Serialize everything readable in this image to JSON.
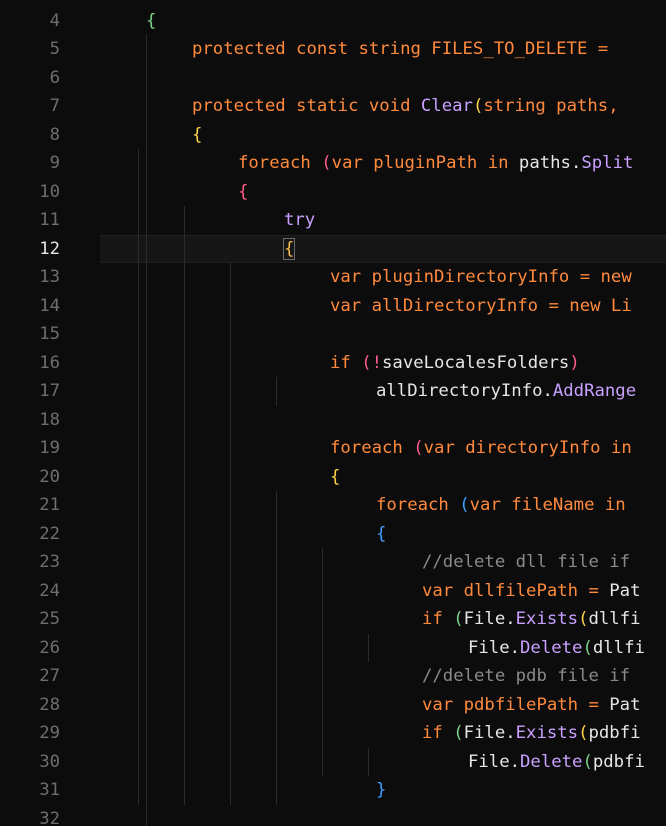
{
  "theme": {
    "background": "#0c0c0c",
    "current_line_background": "#161616",
    "line_number_color": "#6e6e6e",
    "active_line_number_color": "#e6e6e6",
    "colors": {
      "keyword": "#ff8a3d",
      "plain": "#e6e6e6",
      "method": "#c9a0ff",
      "comment": "#8a8a8a",
      "bracket_gold": "#ffd24a",
      "bracket_pink": "#ff5c8a",
      "bracket_green": "#7bd389",
      "bracket_blue": "#3ea0ff",
      "bracket_orange": "#f6b94c"
    }
  },
  "editor": {
    "active_line": "12",
    "lines": [
      {
        "n": "4",
        "indent": 1,
        "tokens": [
          {
            "t": "{",
            "c": "bracket_green"
          }
        ]
      },
      {
        "n": "5",
        "indent": 2,
        "tokens": [
          {
            "t": "protected const string FILES_TO_DELETE = ",
            "c": "keyword"
          }
        ]
      },
      {
        "n": "6",
        "indent": 0,
        "tokens": []
      },
      {
        "n": "7",
        "indent": 2,
        "tokens": [
          {
            "t": "protected static void ",
            "c": "keyword"
          },
          {
            "t": "Clear",
            "c": "method"
          },
          {
            "t": "(",
            "c": "bracket_gold"
          },
          {
            "t": "string paths,",
            "c": "keyword"
          }
        ]
      },
      {
        "n": "8",
        "indent": 2,
        "tokens": [
          {
            "t": "{",
            "c": "bracket_gold"
          }
        ]
      },
      {
        "n": "9",
        "indent": 3,
        "tokens": [
          {
            "t": "foreach ",
            "c": "keyword"
          },
          {
            "t": "(",
            "c": "bracket_pink"
          },
          {
            "t": "var pluginPath in ",
            "c": "keyword"
          },
          {
            "t": "paths.",
            "c": "plain"
          },
          {
            "t": "Split",
            "c": "method"
          }
        ]
      },
      {
        "n": "10",
        "indent": 3,
        "tokens": [
          {
            "t": "{",
            "c": "bracket_pink"
          }
        ]
      },
      {
        "n": "11",
        "indent": 4,
        "tokens": [
          {
            "t": "try",
            "c": "method"
          }
        ]
      },
      {
        "n": "12",
        "indent": 4,
        "tokens": [
          {
            "t": "{",
            "c": "bracket_orange",
            "match": true
          }
        ]
      },
      {
        "n": "13",
        "indent": 5,
        "tokens": [
          {
            "t": "var pluginDirectoryInfo = new",
            "c": "keyword"
          }
        ]
      },
      {
        "n": "14",
        "indent": 5,
        "tokens": [
          {
            "t": "var allDirectoryInfo = new Li",
            "c": "keyword"
          }
        ]
      },
      {
        "n": "15",
        "indent": 0,
        "tokens": []
      },
      {
        "n": "16",
        "indent": 5,
        "tokens": [
          {
            "t": "if ",
            "c": "keyword"
          },
          {
            "t": "(",
            "c": "bracket_pink"
          },
          {
            "t": "!",
            "c": "bracket_pink"
          },
          {
            "t": "saveLocalesFolders",
            "c": "plain"
          },
          {
            "t": ")",
            "c": "bracket_pink"
          }
        ]
      },
      {
        "n": "17",
        "indent": 6,
        "tokens": [
          {
            "t": "allDirectoryInfo.",
            "c": "plain"
          },
          {
            "t": "AddRange",
            "c": "method"
          }
        ]
      },
      {
        "n": "18",
        "indent": 0,
        "tokens": []
      },
      {
        "n": "19",
        "indent": 5,
        "tokens": [
          {
            "t": "foreach ",
            "c": "keyword"
          },
          {
            "t": "(",
            "c": "bracket_pink"
          },
          {
            "t": "var directoryInfo in",
            "c": "keyword"
          }
        ]
      },
      {
        "n": "20",
        "indent": 5,
        "tokens": [
          {
            "t": "{",
            "c": "bracket_gold"
          }
        ]
      },
      {
        "n": "21",
        "indent": 6,
        "tokens": [
          {
            "t": "foreach ",
            "c": "keyword"
          },
          {
            "t": "(",
            "c": "bracket_blue"
          },
          {
            "t": "var fileName in ",
            "c": "keyword"
          }
        ]
      },
      {
        "n": "22",
        "indent": 6,
        "tokens": [
          {
            "t": "{",
            "c": "bracket_blue"
          }
        ]
      },
      {
        "n": "23",
        "indent": 7,
        "tokens": [
          {
            "t": "//delete dll file if",
            "c": "comment"
          }
        ]
      },
      {
        "n": "24",
        "indent": 7,
        "tokens": [
          {
            "t": "var dllfilePath = ",
            "c": "keyword"
          },
          {
            "t": "Pat",
            "c": "plain"
          }
        ]
      },
      {
        "n": "25",
        "indent": 7,
        "tokens": [
          {
            "t": "if ",
            "c": "keyword"
          },
          {
            "t": "(",
            "c": "bracket_green"
          },
          {
            "t": "File.",
            "c": "plain"
          },
          {
            "t": "Exists",
            "c": "method"
          },
          {
            "t": "(",
            "c": "bracket_gold"
          },
          {
            "t": "dllfi",
            "c": "plain"
          }
        ]
      },
      {
        "n": "26",
        "indent": 8,
        "tokens": [
          {
            "t": "File.",
            "c": "plain"
          },
          {
            "t": "Delete",
            "c": "method"
          },
          {
            "t": "(",
            "c": "bracket_green"
          },
          {
            "t": "dllfi",
            "c": "plain"
          }
        ]
      },
      {
        "n": "27",
        "indent": 7,
        "tokens": [
          {
            "t": "//delete pdb file if",
            "c": "comment"
          }
        ]
      },
      {
        "n": "28",
        "indent": 7,
        "tokens": [
          {
            "t": "var pdbfilePath = ",
            "c": "keyword"
          },
          {
            "t": "Pat",
            "c": "plain"
          }
        ]
      },
      {
        "n": "29",
        "indent": 7,
        "tokens": [
          {
            "t": "if ",
            "c": "keyword"
          },
          {
            "t": "(",
            "c": "bracket_green"
          },
          {
            "t": "File.",
            "c": "plain"
          },
          {
            "t": "Exists",
            "c": "method"
          },
          {
            "t": "(",
            "c": "bracket_gold"
          },
          {
            "t": "pdbfi",
            "c": "plain"
          }
        ]
      },
      {
        "n": "30",
        "indent": 8,
        "tokens": [
          {
            "t": "File.",
            "c": "plain"
          },
          {
            "t": "Delete",
            "c": "method"
          },
          {
            "t": "(",
            "c": "bracket_green"
          },
          {
            "t": "pdbfi",
            "c": "plain"
          }
        ]
      },
      {
        "n": "31",
        "indent": 6,
        "tokens": [
          {
            "t": "}",
            "c": "bracket_blue"
          }
        ]
      },
      {
        "n": "32",
        "indent": 0,
        "tokens": []
      }
    ]
  }
}
